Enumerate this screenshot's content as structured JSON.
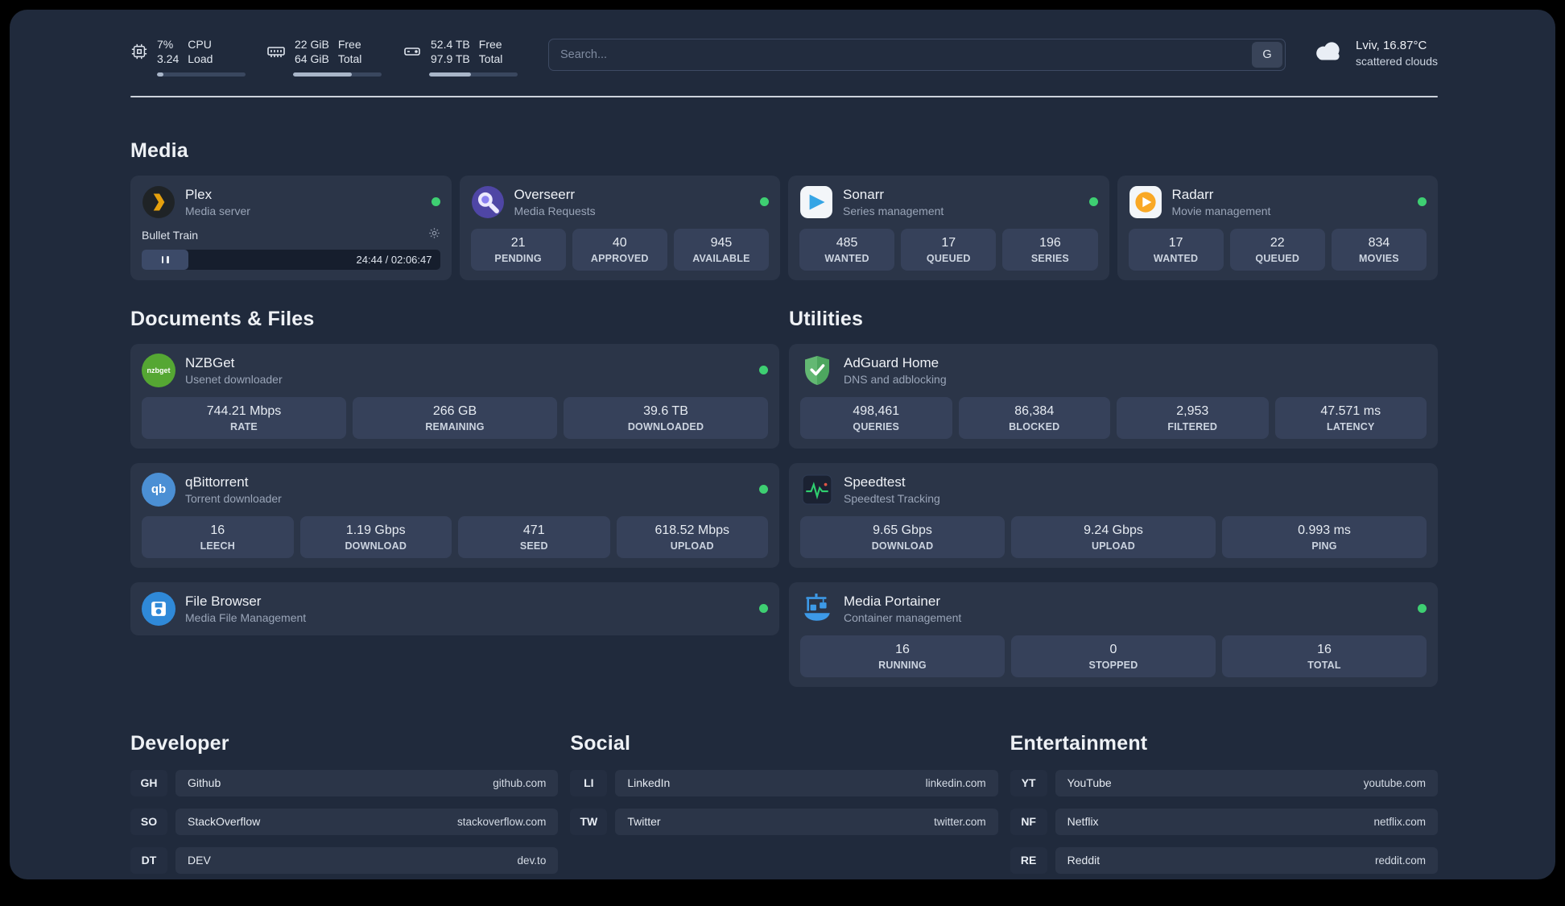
{
  "colors": {
    "status_online": "#3ecf72",
    "accent_blue": "#3d9ae8",
    "plex_amber": "#e5a00d"
  },
  "header": {
    "cpu": {
      "line1": "7%",
      "line2": "3.24",
      "label1": "CPU",
      "label2": "Load",
      "bar_percent": 7
    },
    "ram": {
      "line1": "22 GiB",
      "line2": "64 GiB",
      "label1": "Free",
      "label2": "Total",
      "bar_percent": 66
    },
    "disk": {
      "line1": "52.4 TB",
      "line2": "97.9 TB",
      "label1": "Free",
      "label2": "Total",
      "bar_percent": 47
    },
    "search": {
      "placeholder": "Search...",
      "button_label": "G"
    },
    "weather": {
      "location": "Lviv, 16.87°C",
      "condition": "scattered clouds"
    }
  },
  "sections": {
    "media": {
      "title": "Media"
    },
    "documents": {
      "title": "Documents & Files"
    },
    "utilities": {
      "title": "Utilities"
    },
    "developer": {
      "title": "Developer"
    },
    "social": {
      "title": "Social"
    },
    "entertainment": {
      "title": "Entertainment"
    }
  },
  "apps": {
    "plex": {
      "name": "Plex",
      "desc": "Media server",
      "now_playing": "Bullet Train",
      "time": "24:44 / 02:06:47"
    },
    "overseerr": {
      "name": "Overseerr",
      "desc": "Media Requests",
      "stats": [
        {
          "value": "21",
          "label": "PENDING"
        },
        {
          "value": "40",
          "label": "APPROVED"
        },
        {
          "value": "945",
          "label": "AVAILABLE"
        }
      ]
    },
    "sonarr": {
      "name": "Sonarr",
      "desc": "Series management",
      "stats": [
        {
          "value": "485",
          "label": "WANTED"
        },
        {
          "value": "17",
          "label": "QUEUED"
        },
        {
          "value": "196",
          "label": "SERIES"
        }
      ]
    },
    "radarr": {
      "name": "Radarr",
      "desc": "Movie management",
      "stats": [
        {
          "value": "17",
          "label": "WANTED"
        },
        {
          "value": "22",
          "label": "QUEUED"
        },
        {
          "value": "834",
          "label": "MOVIES"
        }
      ]
    },
    "nzbget": {
      "name": "NZBGet",
      "desc": "Usenet downloader",
      "icon_text": "nzbget",
      "stats": [
        {
          "value": "744.21 Mbps",
          "label": "RATE"
        },
        {
          "value": "266 GB",
          "label": "REMAINING"
        },
        {
          "value": "39.6 TB",
          "label": "DOWNLOADED"
        }
      ]
    },
    "qbittorrent": {
      "name": "qBittorrent",
      "desc": "Torrent downloader",
      "icon_text": "qb",
      "stats": [
        {
          "value": "16",
          "label": "LEECH"
        },
        {
          "value": "1.19 Gbps",
          "label": "DOWNLOAD"
        },
        {
          "value": "471",
          "label": "SEED"
        },
        {
          "value": "618.52 Mbps",
          "label": "UPLOAD"
        }
      ]
    },
    "filebrowser": {
      "name": "File Browser",
      "desc": "Media File Management"
    },
    "adguard": {
      "name": "AdGuard Home",
      "desc": "DNS and adblocking",
      "stats": [
        {
          "value": "498,461",
          "label": "QUERIES"
        },
        {
          "value": "86,384",
          "label": "BLOCKED"
        },
        {
          "value": "2,953",
          "label": "FILTERED"
        },
        {
          "value": "47.571 ms",
          "label": "LATENCY"
        }
      ]
    },
    "speedtest": {
      "name": "Speedtest",
      "desc": "Speedtest Tracking",
      "stats": [
        {
          "value": "9.65 Gbps",
          "label": "DOWNLOAD"
        },
        {
          "value": "9.24 Gbps",
          "label": "UPLOAD"
        },
        {
          "value": "0.993 ms",
          "label": "PING"
        }
      ]
    },
    "portainer": {
      "name": "Media Portainer",
      "desc": "Container management",
      "stats": [
        {
          "value": "16",
          "label": "RUNNING"
        },
        {
          "value": "0",
          "label": "STOPPED"
        },
        {
          "value": "16",
          "label": "TOTAL"
        }
      ]
    }
  },
  "links": {
    "developer": [
      {
        "abbr": "GH",
        "name": "Github",
        "url": "github.com"
      },
      {
        "abbr": "SO",
        "name": "StackOverflow",
        "url": "stackoverflow.com"
      },
      {
        "abbr": "DT",
        "name": "DEV",
        "url": "dev.to"
      }
    ],
    "social": [
      {
        "abbr": "LI",
        "name": "LinkedIn",
        "url": "linkedin.com"
      },
      {
        "abbr": "TW",
        "name": "Twitter",
        "url": "twitter.com"
      }
    ],
    "entertainment": [
      {
        "abbr": "YT",
        "name": "YouTube",
        "url": "youtube.com"
      },
      {
        "abbr": "NF",
        "name": "Netflix",
        "url": "netflix.com"
      },
      {
        "abbr": "RE",
        "name": "Reddit",
        "url": "reddit.com"
      }
    ]
  }
}
